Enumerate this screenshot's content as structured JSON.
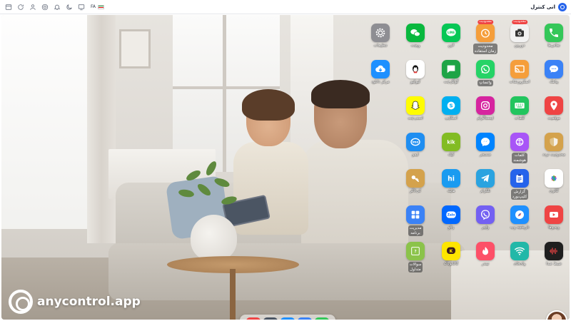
{
  "topbar": {
    "app_title": "انی کنترل",
    "language": "FA"
  },
  "watermark": {
    "text": "anycontrol.app"
  },
  "apps": [
    {
      "id": "phone",
      "label": "تماس‌ها",
      "icon": "phone-icon",
      "color": "#34c759"
    },
    {
      "id": "camera",
      "label": "دوربین",
      "icon": "camera-icon",
      "color": "#f2f2f2",
      "badge": "محدودیت"
    },
    {
      "id": "screen-time",
      "label": "محدودیت\nزمان استفاده",
      "icon": "clock-icon",
      "color": "#f59e3b",
      "badge": "محدودیت",
      "boxed": true
    },
    {
      "id": "line",
      "label": "لاین",
      "icon": "line-icon",
      "color": "#06c755"
    },
    {
      "id": "wechat",
      "label": "ویچت",
      "icon": "wechat-icon",
      "color": "#09b83e"
    },
    {
      "id": "settings",
      "label": "تنظیمات",
      "icon": "gear-icon",
      "color": "#8e8e93"
    },
    {
      "id": "messages",
      "label": "پیامک",
      "icon": "message-icon",
      "color": "#3b82f6"
    },
    {
      "id": "screencast",
      "label": "اسکرین‌شات",
      "icon": "cast-icon",
      "color": "#f59e3b"
    },
    {
      "id": "whatsapp",
      "label": "واتساپ",
      "icon": "whatsapp-icon",
      "color": "#25d366",
      "boxed": true
    },
    {
      "id": "google-chat",
      "label": "گوگل‌چت",
      "icon": "google-chat-icon",
      "color": "#1ea446"
    },
    {
      "id": "qq",
      "label": "کیوکیو",
      "icon": "qq-icon",
      "color": "#ffffff"
    },
    {
      "id": "download-center",
      "label": "مرکز دانلود",
      "icon": "cloud-download-icon",
      "color": "#1e90ff"
    },
    {
      "id": "location",
      "label": "موقعیت",
      "icon": "location-pin-icon",
      "color": "#ef4444"
    },
    {
      "id": "keyboard",
      "label": "کلمات",
      "icon": "keyboard-icon",
      "color": "#22c55e"
    },
    {
      "id": "instagram",
      "label": "اینستاگرام",
      "icon": "instagram-icon",
      "color": "#d6249f"
    },
    {
      "id": "skype",
      "label": "اسکایپ",
      "icon": "skype-icon",
      "color": "#00aff0"
    },
    {
      "id": "snapchat",
      "label": "اسنپ‌چت",
      "icon": "snapchat-icon",
      "color": "#fffc00"
    },
    {
      "id": "traffic-limit",
      "label": "محدودیت تردد",
      "icon": "shield-icon",
      "color": "#d4a24c"
    },
    {
      "id": "smart-words",
      "label": "کلمات\nهوشمند",
      "icon": "brain-icon",
      "color": "#a855f7",
      "boxed": true
    },
    {
      "id": "messenger",
      "label": "مسنجر",
      "icon": "messenger-icon",
      "color": "#0084ff"
    },
    {
      "id": "kik",
      "label": "کیک",
      "icon": "kik-icon",
      "color": "#82bc23"
    },
    {
      "id": "imo",
      "label": "ایمو",
      "icon": "imo-icon",
      "color": "#1f8ef1"
    },
    {
      "id": "gallery",
      "label": "گالری",
      "icon": "photos-icon",
      "color": "#ffffff"
    },
    {
      "id": "clipboard",
      "label": "گزارش\nکلیپ‌بورد",
      "icon": "clipboard-icon",
      "color": "#2563eb",
      "boxed": true
    },
    {
      "id": "telegram",
      "label": "تلگرام",
      "icon": "telegram-icon",
      "color": "#2aa3e0"
    },
    {
      "id": "hike",
      "label": "هایک",
      "icon": "hike-icon",
      "color": "#1a9bf0"
    },
    {
      "id": "keylogger",
      "label": "کی‌لاگر",
      "icon": "key-icon",
      "color": "#d4a24c"
    },
    {
      "id": "videos",
      "label": "ویدیوها",
      "icon": "video-play-icon",
      "color": "#ef4444"
    },
    {
      "id": "web-history",
      "label": "تاریخچه وب",
      "icon": "safari-icon",
      "color": "#1e90ff"
    },
    {
      "id": "viber",
      "label": "وایبر",
      "icon": "viber-icon",
      "color": "#7360f2"
    },
    {
      "id": "zalo",
      "label": "زالو",
      "icon": "zalo-icon",
      "color": "#0068ff"
    },
    {
      "id": "app-manager",
      "label": "مدیریت\nبرنامه",
      "icon": "grid-icon",
      "color": "#3b82f6",
      "boxed": true
    },
    {
      "id": "voice-record",
      "label": "ضبط صدا",
      "icon": "waveform-icon",
      "color": "#1f1f1f"
    },
    {
      "id": "wifi",
      "label": "وای‌فای",
      "icon": "wifi-icon",
      "color": "#22b8a8"
    },
    {
      "id": "tinder",
      "label": "تیندر",
      "icon": "tinder-icon",
      "color": "#fd5068"
    },
    {
      "id": "kakaotalk",
      "label": "کاکائوتاک",
      "icon": "kakaotalk-icon",
      "color": "#fee500"
    },
    {
      "id": "faq",
      "label": "سوالات\nمتداول",
      "icon": "faq-icon",
      "color": "#8bc34a",
      "boxed": true
    }
  ],
  "dock": [
    {
      "id": "dock-location",
      "icon": "location-pin-icon",
      "color": "#ef4444"
    },
    {
      "id": "dock-settings",
      "icon": "gear-icon",
      "color": "#4b5563"
    },
    {
      "id": "dock-safari",
      "icon": "safari-icon",
      "color": "#1e90ff"
    },
    {
      "id": "dock-messages",
      "icon": "message-icon",
      "color": "#3b82f6"
    },
    {
      "id": "dock-phone",
      "icon": "phone-icon",
      "color": "#34c759"
    }
  ]
}
